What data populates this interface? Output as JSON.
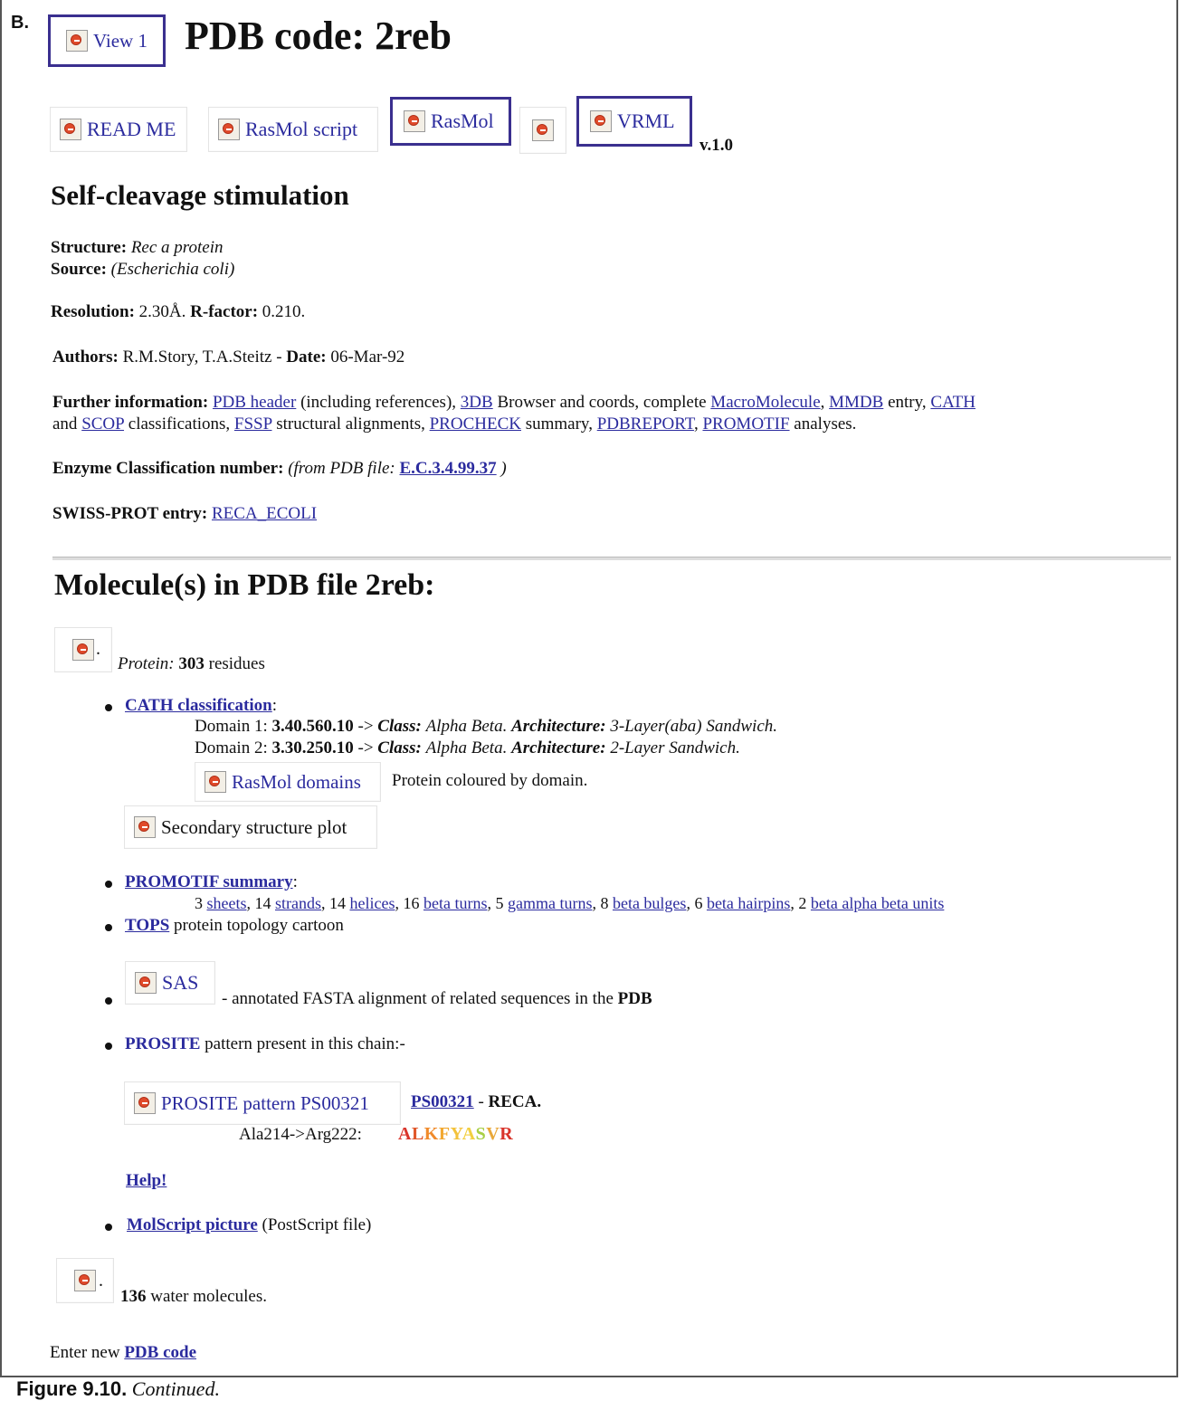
{
  "panel_letter": "B.",
  "header": {
    "view_button": "View 1",
    "title": "PDB code: 2reb"
  },
  "toolbar": {
    "readme": "READ ME",
    "rasmol_script": "RasMol script",
    "rasmol": "RasMol",
    "vrml": "VRML",
    "version": "v.1.0"
  },
  "section_title": "Self-cleavage stimulation",
  "info": {
    "structure_label": "Structure:",
    "structure_value": "Rec a protein",
    "source_label": "Source:",
    "source_value": "(Escherichia coli)",
    "resolution_label": "Resolution:",
    "resolution_value": "2.30Å.",
    "rfactor_label": "R-factor:",
    "rfactor_value": "0.210.",
    "authors_label": "Authors:",
    "authors_value": "R.M.Story, T.A.Steitz",
    "date_sep": "-",
    "date_label": "Date:",
    "date_value": "06-Mar-92",
    "further_label": "Further information:",
    "links": {
      "pdb_header": "PDB header",
      "threedb": "3DB",
      "macromolecule": "MacroMolecule",
      "mmdb": "MMDB",
      "cath": "CATH",
      "scop": "SCOP",
      "fssp": "FSSP",
      "procheck": "PROCHECK",
      "pdbreport": "PDBREPORT",
      "promotif": "PROMOTIF"
    },
    "text": {
      "t1": " (including references), ",
      "t2": " Browser and coords, complete ",
      "t3": ", ",
      "t4": " entry, ",
      "t5": "and ",
      "t6": " classifications, ",
      "t7": " structural alignments, ",
      "t8": " summary, ",
      "t9": ", ",
      "t10": " analyses."
    },
    "enzyme_label": "Enzyme Classification number:",
    "enzyme_prefix": "(from PDB file:",
    "enzyme_link": "E.C.3.4.99.37",
    "enzyme_suffix": ")",
    "swiss_label": "SWISS-PROT entry:",
    "swiss_link": "RECA_ECOLI"
  },
  "molecules": {
    "title": "Molecule(s) in PDB file 2reb:",
    "protein_label": "Protein:",
    "protein_count": "303",
    "protein_unit": "residues",
    "cath": {
      "link": "CATH classification",
      "colon": ":",
      "domains": [
        {
          "prefix": "Domain 1:",
          "code": "3.40.560.10",
          "arrow": "->",
          "class_label": "Class:",
          "class_value": "Alpha Beta.",
          "arch_label": "Architecture:",
          "arch_value": "3-Layer(aba) Sandwich."
        },
        {
          "prefix": "Domain 2:",
          "code": "3.30.250.10",
          "arrow": "->",
          "class_label": "Class:",
          "class_value": "Alpha Beta.",
          "arch_label": "Architecture:",
          "arch_value": "2-Layer Sandwich."
        }
      ],
      "rasmol_domains": "RasMol domains",
      "rasmol_domains_desc": "Protein coloured by domain.",
      "ss_plot": "Secondary structure plot"
    },
    "promotif": {
      "link": "PROMOTIF summary",
      "colon": ":",
      "counts": {
        "sheets": "3",
        "strands": "14",
        "helices": "14",
        "beta_turns": "16",
        "gamma_turns": "5",
        "beta_bulges": "8",
        "beta_hairpins": "6",
        "bab_units": "2"
      },
      "labels": {
        "sheets": "sheets",
        "strands": "strands",
        "helices": "helices",
        "beta_turns": "beta turns",
        "gamma_turns": "gamma turns",
        "beta_bulges": "beta bulges",
        "beta_hairpins": "beta hairpins",
        "bab_units": "beta alpha beta units"
      }
    },
    "tops": {
      "link": "TOPS",
      "text": "protein topology cartoon"
    },
    "sas": {
      "button": "SAS",
      "text": "- annotated FASTA alignment of related sequences in the",
      "bold": "PDB"
    },
    "prosite": {
      "link": "PROSITE",
      "text": "pattern present in this chain:-",
      "button": "PROSITE pattern PS00321",
      "code_link": "PS00321",
      "sep": "-",
      "name": "RECA.",
      "range": "Ala214->Arg222:",
      "sequence": [
        {
          "c": "A",
          "col": "#d9342b"
        },
        {
          "c": "L",
          "col": "#e0572a"
        },
        {
          "c": "K",
          "col": "#f08a2a"
        },
        {
          "c": "F",
          "col": "#f2a830"
        },
        {
          "c": "Y",
          "col": "#f3c23a"
        },
        {
          "c": "A",
          "col": "#f2cf40"
        },
        {
          "c": "S",
          "col": "#a8cf45"
        },
        {
          "c": "V",
          "col": "#e9a83a"
        },
        {
          "c": "R",
          "col": "#d9342b"
        }
      ],
      "help": "Help!"
    },
    "molscript": {
      "link": "MolScript picture",
      "text": "(PostScript file)"
    },
    "water": {
      "count": "136",
      "text": "water molecules."
    }
  },
  "footer": {
    "prefix": "Enter new",
    "link": "PDB code"
  },
  "caption": {
    "label": "Figure 9.10.",
    "text": "Continued."
  }
}
